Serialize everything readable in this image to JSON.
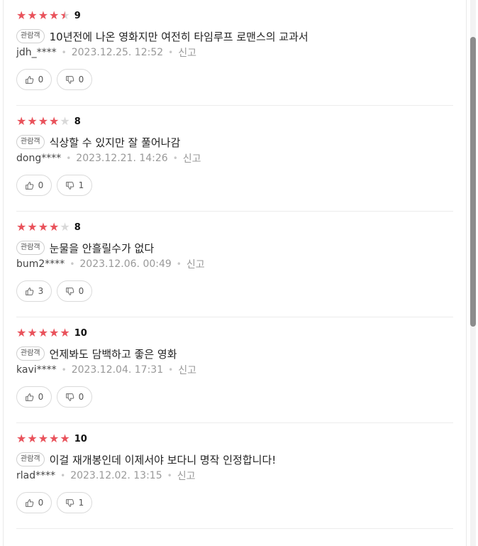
{
  "reviews": [
    {
      "stars": [
        "full",
        "full",
        "full",
        "full",
        "half"
      ],
      "score": "9",
      "badge": "관람객",
      "comment": "10년전에 나온 영화지만 여전히 타임루프 로맨스의 교과서",
      "user": "jdh_****",
      "date": "2023.12.25. 12:52",
      "report": "신고",
      "likes": "0",
      "dislikes": "0"
    },
    {
      "stars": [
        "full",
        "full",
        "full",
        "full",
        "empty"
      ],
      "score": "8",
      "badge": "관람객",
      "comment": "식상할 수 있지만 잘 풀어나감",
      "user": "dong****",
      "date": "2023.12.21. 14:26",
      "report": "신고",
      "likes": "0",
      "dislikes": "1"
    },
    {
      "stars": [
        "full",
        "full",
        "full",
        "full",
        "empty"
      ],
      "score": "8",
      "badge": "관람객",
      "comment": "눈물을 안흘릴수가 없다",
      "user": "bum2****",
      "date": "2023.12.06. 00:49",
      "report": "신고",
      "likes": "3",
      "dislikes": "0"
    },
    {
      "stars": [
        "full",
        "full",
        "full",
        "full",
        "full"
      ],
      "score": "10",
      "badge": "관람객",
      "comment": "언제봐도 담백하고 좋은 영화",
      "user": "kavi****",
      "date": "2023.12.04. 17:31",
      "report": "신고",
      "likes": "0",
      "dislikes": "0"
    },
    {
      "stars": [
        "full",
        "full",
        "full",
        "full",
        "full"
      ],
      "score": "10",
      "badge": "관람객",
      "comment": "이걸 재개봉인데 이제서야 보다니 명작 인정합니다!",
      "user": "rlad****",
      "date": "2023.12.02. 13:15",
      "report": "신고",
      "likes": "0",
      "dislikes": "1"
    }
  ],
  "colors": {
    "star": "#e9525b",
    "star_empty": "#d9d9d9",
    "meta": "#999999"
  },
  "icons": {
    "like": "thumbs-up-icon",
    "dislike": "thumbs-down-icon",
    "star": "star-icon"
  }
}
